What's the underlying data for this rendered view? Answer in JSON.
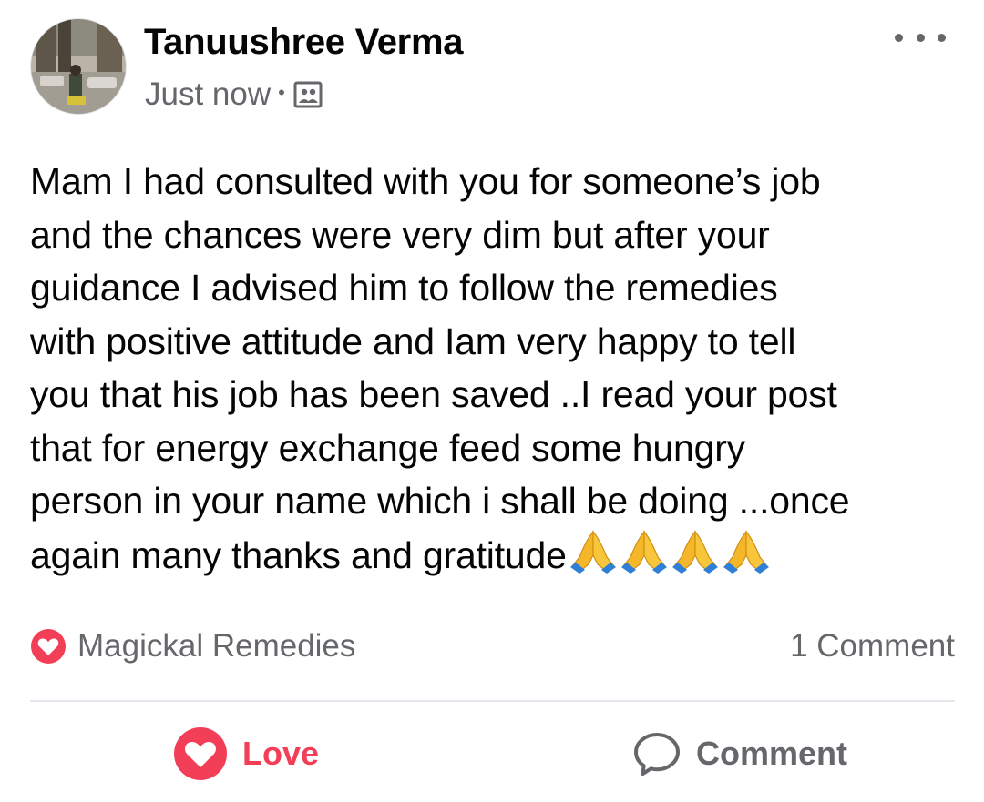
{
  "post": {
    "author_name": "Tanuushree Verma",
    "timestamp": "Just now",
    "separator": "•",
    "privacy_icon": "group-privacy-icon",
    "more_icon": "more-options-icon",
    "text_lines": [
      "Mam I had consulted with you for someone’s job",
      "and the chances were very dim but after your",
      "guidance I advised him to follow the remedies",
      "with positive attitude and Iam very happy to tell",
      "you that his job has been saved ..I read your post",
      "that for energy exchange feed some hungry",
      "person in your name which i shall be doing ...once",
      "again many thanks and gratitude"
    ],
    "emoji": [
      "folded-hands-emoji",
      "folded-hands-emoji",
      "folded-hands-emoji",
      "folded-hands-emoji"
    ]
  },
  "reactions": {
    "reactor_name": "Magickal Remedies",
    "reaction_icon": "love-reaction-icon",
    "comment_count": "1 Comment"
  },
  "actions": {
    "love_label": "Love",
    "comment_label": "Comment"
  },
  "colors": {
    "love_red": "#f33e58",
    "meta_gray": "#65676b",
    "text_black": "#050505",
    "divider": "#e4e6eb"
  }
}
